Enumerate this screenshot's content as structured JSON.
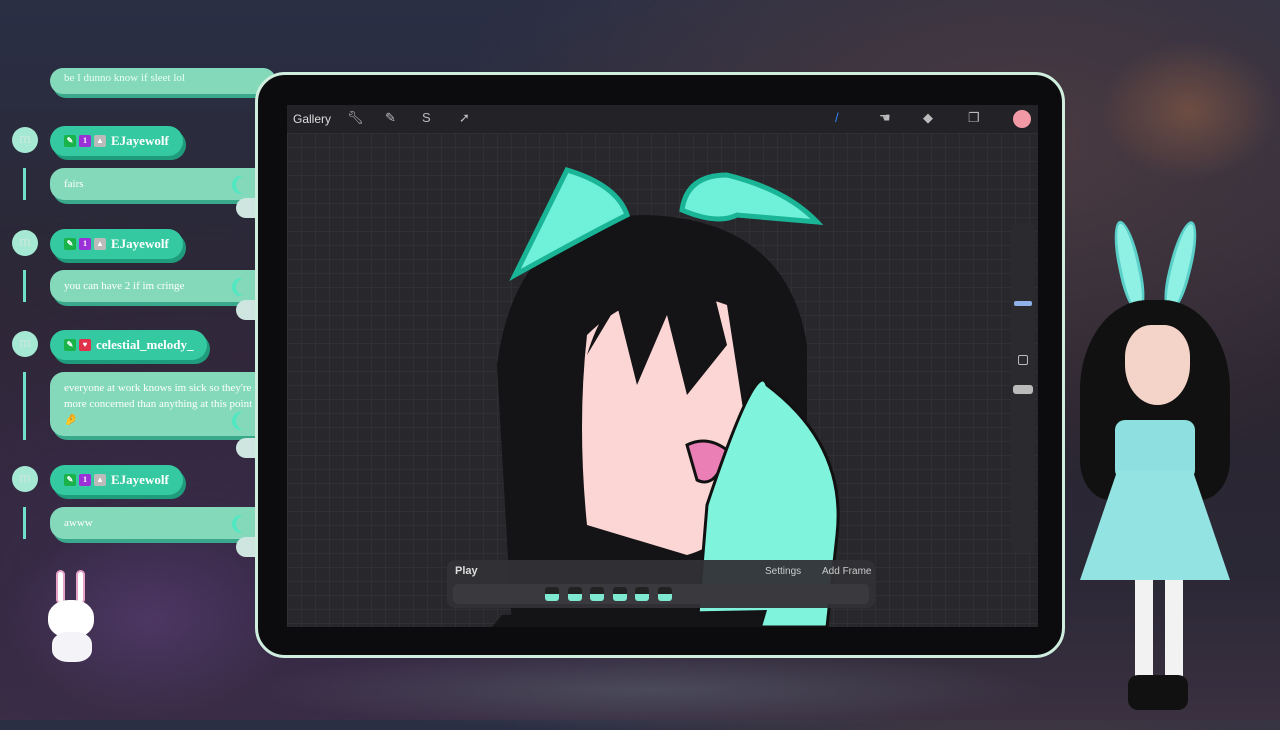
{
  "chat": {
    "partial_message": "be I dunno know if sleet lol",
    "messages": [
      {
        "avatar": "m",
        "user": "EJayewolf",
        "badges": [
          "pen-badge",
          "sub-badge",
          "mod-badge"
        ],
        "text": "fairs"
      },
      {
        "avatar": "m",
        "user": "EJayewolf",
        "badges": [
          "pen-badge",
          "sub-badge",
          "mod-badge"
        ],
        "text": "you can have 2 if im cringe"
      },
      {
        "avatar": "m",
        "user": "celestial_melody_",
        "badges": [
          "pen-badge",
          "heart-badge"
        ],
        "text": "everyone at work knows im sick so they're more concerned than anything at this point 🤌"
      },
      {
        "avatar": "m",
        "user": "EJayewolf",
        "badges": [
          "pen-badge",
          "sub-badge",
          "mod-badge"
        ],
        "text": "awww"
      }
    ]
  },
  "procreate": {
    "gallery": "Gallery",
    "tools_left": [
      "wrench-icon",
      "magic-wand-icon",
      "selection-icon",
      "transform-arrow-icon"
    ],
    "tools_right": [
      "brush-icon",
      "smudge-icon",
      "eraser-icon",
      "layers-icon",
      "color-swatch"
    ],
    "color": "#f19aa6",
    "animation": {
      "play": "Play",
      "settings": "Settings",
      "add_frame": "Add Frame",
      "frame_count": 6
    }
  }
}
